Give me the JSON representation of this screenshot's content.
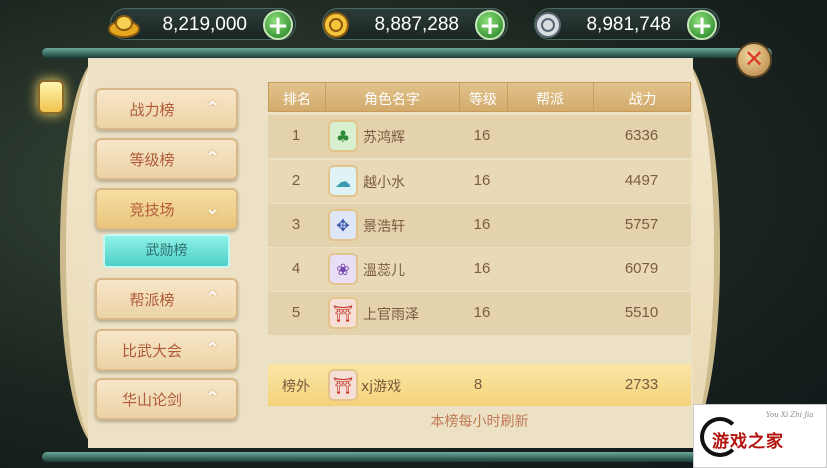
{
  "currencies": [
    {
      "icon": "gold-ingot-icon",
      "value": "8,219,000",
      "add_label": "+"
    },
    {
      "icon": "gold-coin-icon",
      "value": "8,887,288",
      "add_label": "+"
    },
    {
      "icon": "silver-coin-icon",
      "value": "8,981,748",
      "add_label": "+"
    }
  ],
  "close_label": "✕",
  "menu": {
    "items": [
      {
        "label": "战力榜",
        "chevron": "⌃"
      },
      {
        "label": "等级榜",
        "chevron": "⌃"
      },
      {
        "label": "竞技场",
        "chevron": "⌄"
      },
      {
        "label": "帮派榜",
        "chevron": "⌃"
      },
      {
        "label": "比武大会",
        "chevron": "⌃"
      },
      {
        "label": "华山论剑",
        "chevron": "⌃"
      }
    ],
    "sub_item": "武勋榜"
  },
  "table": {
    "headers": [
      "排名",
      "角色名字",
      "等级",
      "帮派",
      "战力"
    ],
    "rows": [
      {
        "rank": "1",
        "name": "苏鸿辉",
        "level": "16",
        "guild": "",
        "power": "6336",
        "avatar": "green-emblem-icon"
      },
      {
        "rank": "2",
        "name": "越小水",
        "level": "16",
        "guild": "",
        "power": "4497",
        "avatar": "cloud-emblem-icon"
      },
      {
        "rank": "3",
        "name": "景浩轩",
        "level": "16",
        "guild": "",
        "power": "5757",
        "avatar": "blue-emblem-icon"
      },
      {
        "rank": "4",
        "name": "溫蕊儿",
        "level": "16",
        "guild": "",
        "power": "6079",
        "avatar": "purple-emblem-icon"
      },
      {
        "rank": "5",
        "name": "上官雨泽",
        "level": "16",
        "guild": "",
        "power": "5510",
        "avatar": "red-emblem-icon"
      }
    ]
  },
  "my_rank": {
    "rank": "榜外",
    "name": "xj游戏",
    "level": "8",
    "guild": "",
    "power": "2733",
    "avatar": "red-emblem-icon"
  },
  "footer_note": "本榜每小时刷新",
  "watermark": {
    "main": "游戏之家",
    "sub": "You Xi Zhi Jia"
  },
  "colors": {
    "accent": "#d2ab6c",
    "text": "#7a5b3f",
    "highlight": "#f3d27a",
    "sub_button": "#4ecfc6"
  }
}
